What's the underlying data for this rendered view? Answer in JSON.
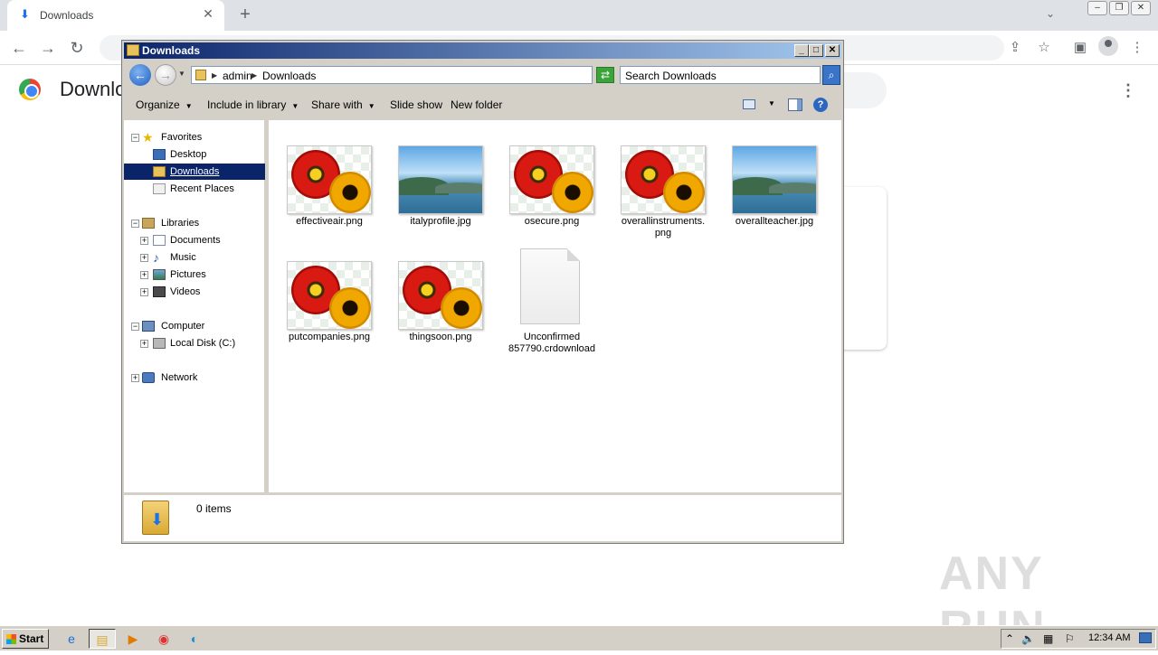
{
  "browser": {
    "tab_title": "Downloads",
    "page_title": "Downlo",
    "watermark": "ANY RUN"
  },
  "explorer": {
    "window_title": "Downloads",
    "address": [
      "admin",
      "Downloads"
    ],
    "search_placeholder": "Search Downloads",
    "toolbar": {
      "organize": "Organize",
      "include_in_library": "Include in library",
      "share_with": "Share with",
      "slide_show": "Slide show",
      "new_folder": "New folder"
    },
    "nav": {
      "favorites": "Favorites",
      "desktop": "Desktop",
      "downloads": "Downloads",
      "recent_places": "Recent Places",
      "libraries": "Libraries",
      "documents": "Documents",
      "music": "Music",
      "pictures": "Pictures",
      "videos": "Videos",
      "computer": "Computer",
      "local_disk": "Local Disk (C:)",
      "network": "Network"
    },
    "files": [
      {
        "name": "effectiveair.png",
        "thumb": "flower"
      },
      {
        "name": "italyprofile.jpg",
        "thumb": "lake"
      },
      {
        "name": "osecure.png",
        "thumb": "flower"
      },
      {
        "name": "overallinstruments.png",
        "line1": "overallinstruments.",
        "line2": "png",
        "thumb": "flower"
      },
      {
        "name": "overallteacher.jpg",
        "thumb": "lake"
      },
      {
        "name": "putcompanies.png",
        "thumb": "flower"
      },
      {
        "name": "thingsoon.png",
        "thumb": "flower"
      },
      {
        "name": "Unconfirmed 857790.crdownload",
        "line1": "Unconfirmed",
        "line2": "857790.crdownload",
        "thumb": "document"
      }
    ],
    "status": "0 items"
  },
  "taskbar": {
    "start": "Start",
    "clock": "12:34 AM"
  }
}
